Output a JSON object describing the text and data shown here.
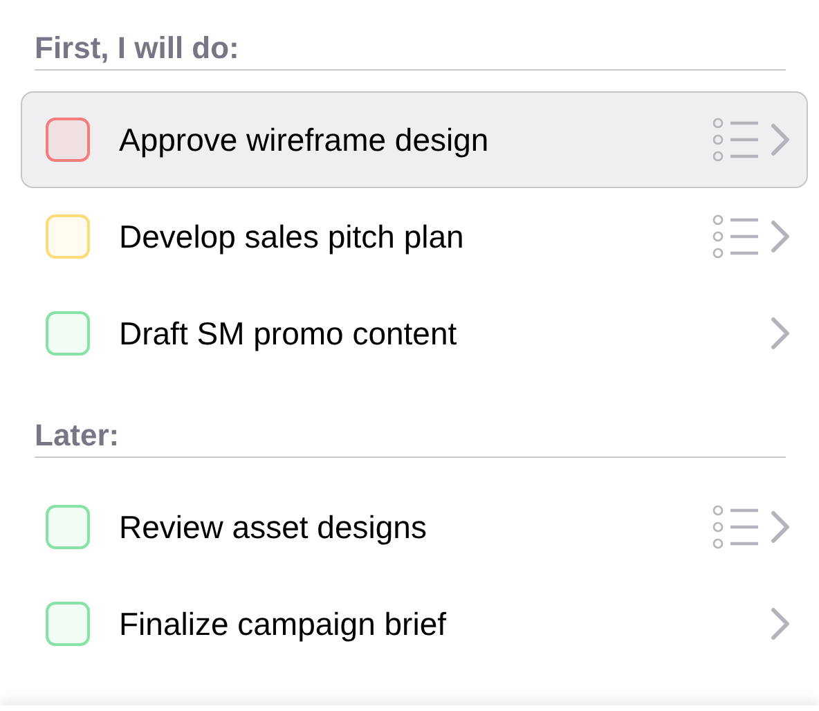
{
  "sections": [
    {
      "title": "First, I will do:",
      "tasks": [
        {
          "label": "Approve wireframe design",
          "color": "#f47c7c",
          "checked": false,
          "selected": true,
          "has_notes": true
        },
        {
          "label": "Develop sales pitch plan",
          "color": "#fddb7a",
          "checked": false,
          "selected": false,
          "has_notes": true
        },
        {
          "label": "Draft SM promo content",
          "color": "#86e3a4",
          "checked": false,
          "selected": false,
          "has_notes": false
        }
      ]
    },
    {
      "title": "Later:",
      "tasks": [
        {
          "label": "Review asset designs",
          "color": "#86e3a4",
          "checked": false,
          "selected": false,
          "has_notes": true
        },
        {
          "label": "Finalize campaign brief",
          "color": "#86e3a4",
          "checked": false,
          "selected": false,
          "has_notes": false
        }
      ]
    }
  ]
}
